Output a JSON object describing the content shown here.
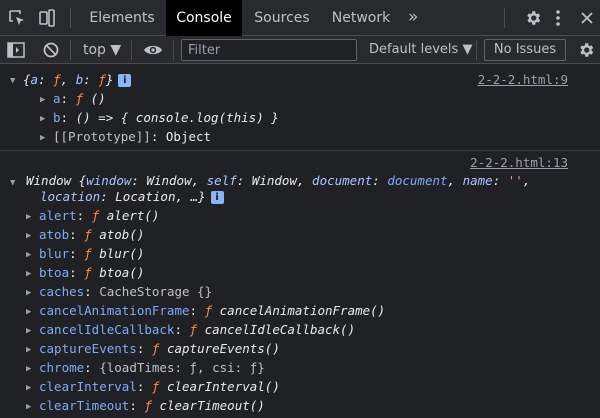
{
  "tabs": [
    {
      "label": "Elements"
    },
    {
      "label": "Console"
    },
    {
      "label": "Sources"
    },
    {
      "label": "Network"
    }
  ],
  "tabs_more": "»",
  "toolbar": {
    "context": "top ▼",
    "filter_placeholder": "Filter",
    "levels": "Default levels ▼",
    "issues": "No Issues"
  },
  "messages": [
    {
      "source": "2-2-2.html:9",
      "summary": {
        "open": "{",
        "k1": "a",
        "c1": ": ",
        "f1": "ƒ",
        "sep": ", ",
        "k2": "b",
        "c2": ": ",
        "f2": "ƒ",
        "close": "}"
      },
      "badge": "i",
      "props": [
        {
          "key": "a",
          "colon": ": ",
          "f": "ƒ",
          "rest": " ()"
        },
        {
          "key": "b",
          "colon": ": ",
          "rest": "() => { console.log(this) }"
        },
        {
          "key": "[[Prototype]]",
          "colon": ": ",
          "rest": "Object"
        }
      ]
    },
    {
      "source": "2-2-2.html:13",
      "summary_l1": {
        "name": "Window",
        "open": " {",
        "k1": "window",
        "v1": "Window",
        "k2": "self",
        "v2": "Window",
        "k3": "document",
        "v3": "document",
        "k4": "name",
        "v4": "''",
        "tail": ","
      },
      "summary_l2": {
        "k5": "location",
        "v5": "Location",
        "ellipsis": "…}"
      },
      "badge": "i",
      "props": [
        {
          "key": "alert",
          "colon": ": ",
          "f": "ƒ",
          "rest": "alert()"
        },
        {
          "key": "atob",
          "colon": ": ",
          "f": "ƒ",
          "rest": "atob()"
        },
        {
          "key": "blur",
          "colon": ": ",
          "f": "ƒ",
          "rest": "blur()"
        },
        {
          "key": "btoa",
          "colon": ": ",
          "f": "ƒ",
          "rest": "btoa()"
        },
        {
          "key": "caches",
          "colon": ": ",
          "val": "CacheStorage {}"
        },
        {
          "key": "cancelAnimationFrame",
          "colon": ": ",
          "f": "ƒ",
          "rest": "cancelAnimationFrame()"
        },
        {
          "key": "cancelIdleCallback",
          "colon": ": ",
          "f": "ƒ",
          "rest": "cancelIdleCallback()"
        },
        {
          "key": "captureEvents",
          "colon": ": ",
          "f": "ƒ",
          "rest": "captureEvents()"
        },
        {
          "key": "chrome",
          "colon": ": ",
          "val": "{loadTimes: ƒ, csi: ƒ}"
        },
        {
          "key": "clearInterval",
          "colon": ": ",
          "f": "ƒ",
          "rest": "clearInterval()"
        },
        {
          "key": "clearTimeout",
          "colon": ": ",
          "f": "ƒ",
          "rest": "clearTimeout()"
        }
      ]
    }
  ],
  "colors": {
    "accent_blue": "#8ab4f8",
    "key_blue": "#7cacf8",
    "function_orange": "#ff8a47",
    "string_red": "#f28b82",
    "link_grey": "#9aa0a6"
  },
  "icons": [
    "inspect-element-icon",
    "device-toolbar-icon",
    "settings-gear-icon",
    "more-vertical-icon",
    "close-icon",
    "sidebar-toggle-icon",
    "clear-console-icon",
    "eye-icon",
    "expand-triangle-icon",
    "info-badge-icon"
  ]
}
